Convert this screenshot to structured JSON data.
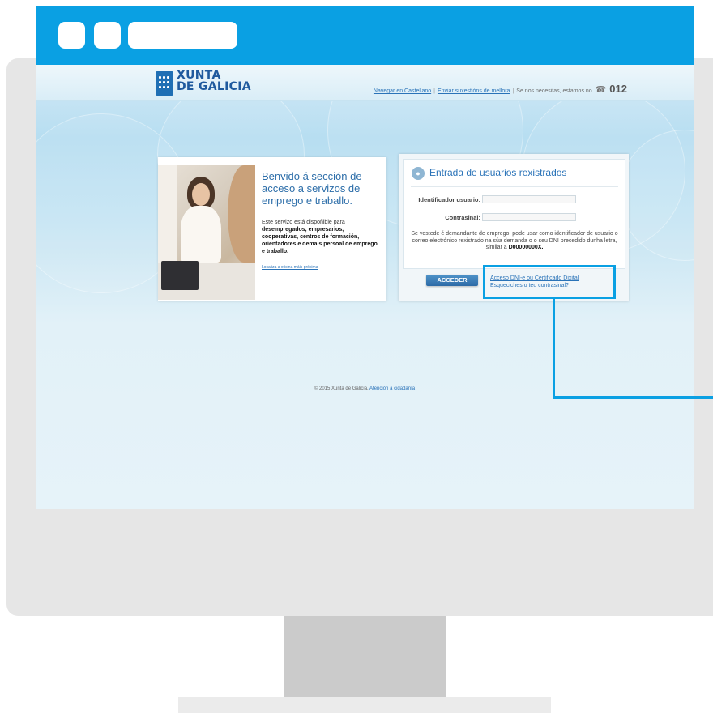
{
  "header": {
    "logo_line1": "XUNTA",
    "logo_line2": "DE GALICIA",
    "link_castellano": "Navegar en Castellano",
    "separator": "|",
    "link_suxestions": "Enviar suxestións de mellora",
    "help_text": "Se nos necesitas, estamos no",
    "phone_icon": "☎",
    "phone_number": "012"
  },
  "welcome": {
    "title": "Benvido á sección de acceso a servizos de emprego e traballo.",
    "text_intro": "Este servizo está dispoñible para",
    "text_bold": "desempregados, empresarios, cooperativas, centros de formación, orientadores e demais persoal de emprego e traballo.",
    "link": "Localiza a oficina máis próxima"
  },
  "login": {
    "title": "Entrada de usuarios rexistrados",
    "icon": "lock-icon",
    "user_label": "Identificador usuario:",
    "user_value": "",
    "password_label": "Contrasinal:",
    "password_value": "",
    "info_text": "Se vostede é demandante de emprego, pode usar como identificador de usuario o correo electrónico rexistrado na súa demanda o o seu DNI precedido dunha letra, similar a",
    "info_example": "D00000000X.",
    "submit_label": "ACCEDER",
    "link_dnie": "Acceso DNI-e ou Certificado Dixital",
    "link_forgot": "Esqueciches o teu contrasinal?"
  },
  "footer": {
    "copyright": "© 2015 Xunta de Galicia.",
    "link": "Atención á cidadanía"
  },
  "colors": {
    "accent": "#0aa0e3",
    "link": "#2a73b8",
    "button": "#2c6aa6"
  }
}
